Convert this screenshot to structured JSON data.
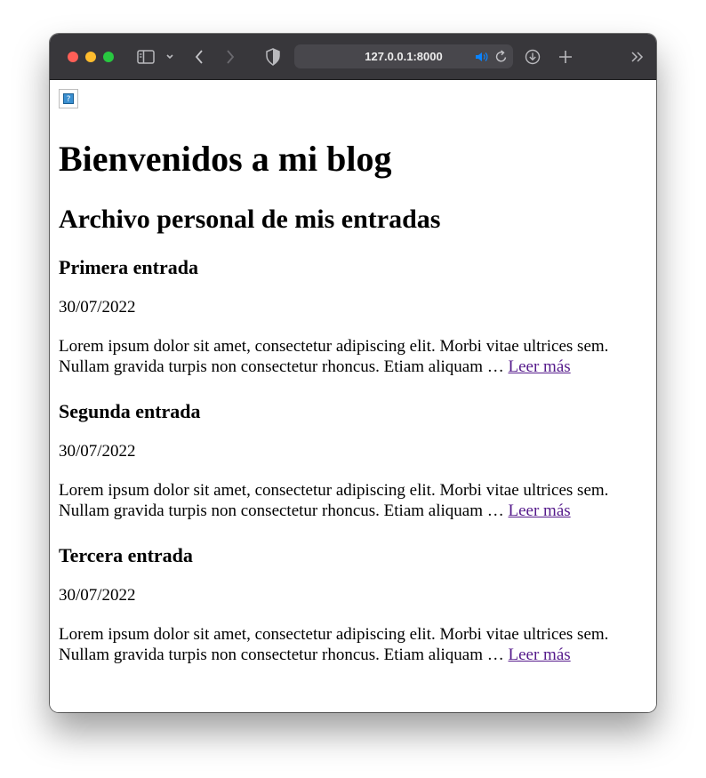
{
  "browser": {
    "url": "127.0.0.1:8000",
    "icons": [
      "sidebar-icon",
      "chevron-down-icon",
      "back-icon",
      "forward-icon",
      "shield-icon",
      "speaker-icon",
      "reload-icon",
      "download-icon",
      "new-tab-icon",
      "overflow-icon"
    ],
    "colors": {
      "toolbar": "#38373b",
      "urlbar": "#48474c",
      "speaker": "#0a84ff"
    }
  },
  "page": {
    "title": "Bienvenidos a mi blog",
    "subtitle": "Archivo personal de mis entradas",
    "posts": [
      {
        "title": "Primera entrada",
        "date": "30/07/2022",
        "excerpt": "Lorem ipsum dolor sit amet, consectetur adipiscing elit. Morbi vitae ultrices sem. Nullam gravida turpis non consectetur rhoncus. Etiam aliquam … ",
        "link": "Leer más"
      },
      {
        "title": "Segunda entrada",
        "date": "30/07/2022",
        "excerpt": "Lorem ipsum dolor sit amet, consectetur adipiscing elit. Morbi vitae ultrices sem. Nullam gravida turpis non consectetur rhoncus. Etiam aliquam … ",
        "link": "Leer más"
      },
      {
        "title": "Tercera entrada",
        "date": "30/07/2022",
        "excerpt": "Lorem ipsum dolor sit amet, consectetur adipiscing elit. Morbi vitae ultrices sem. Nullam gravida turpis non consectetur rhoncus. Etiam aliquam … ",
        "link": "Leer más"
      }
    ],
    "colors": {
      "link": "#551a8b"
    }
  }
}
